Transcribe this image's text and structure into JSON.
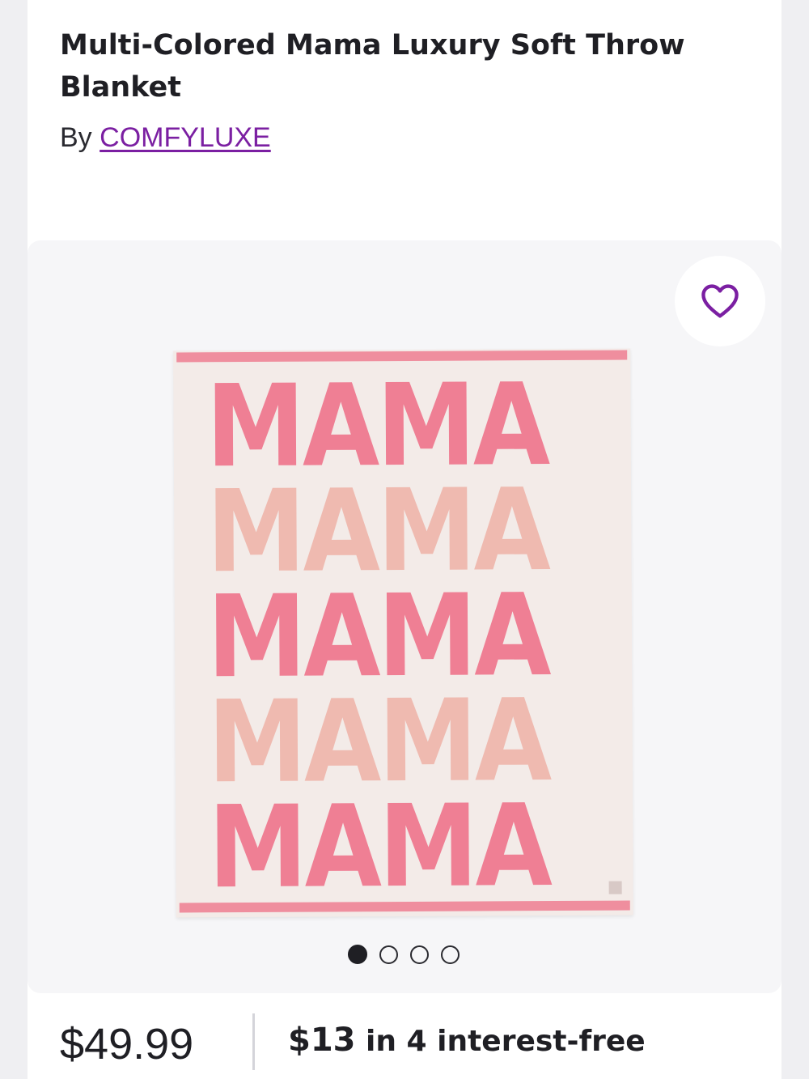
{
  "product": {
    "title": "Multi-Colored Mama Luxury Soft Throw Blanket",
    "by_prefix": "By",
    "brand": "COMFYLUXE"
  },
  "gallery": {
    "favorite_icon": "heart-outline-icon",
    "image_text_lines": [
      "MAMA",
      "MAMA",
      "MAMA",
      "MAMA",
      "MAMA"
    ],
    "line_colors": [
      "#ef7f94",
      "#efbab0",
      "#ef7f94",
      "#efbab0",
      "#ef7f94"
    ],
    "dots_total": 4,
    "active_dot": 0
  },
  "pricing": {
    "price": "$49.99",
    "installment_amount": "$13",
    "installment_text": " in 4 interest-free"
  },
  "colors": {
    "brand_link": "#7b1fa2",
    "heart": "#7b1fa2",
    "blanket_bg": "#f3ebe8",
    "blanket_border": "#ef8e9e"
  }
}
